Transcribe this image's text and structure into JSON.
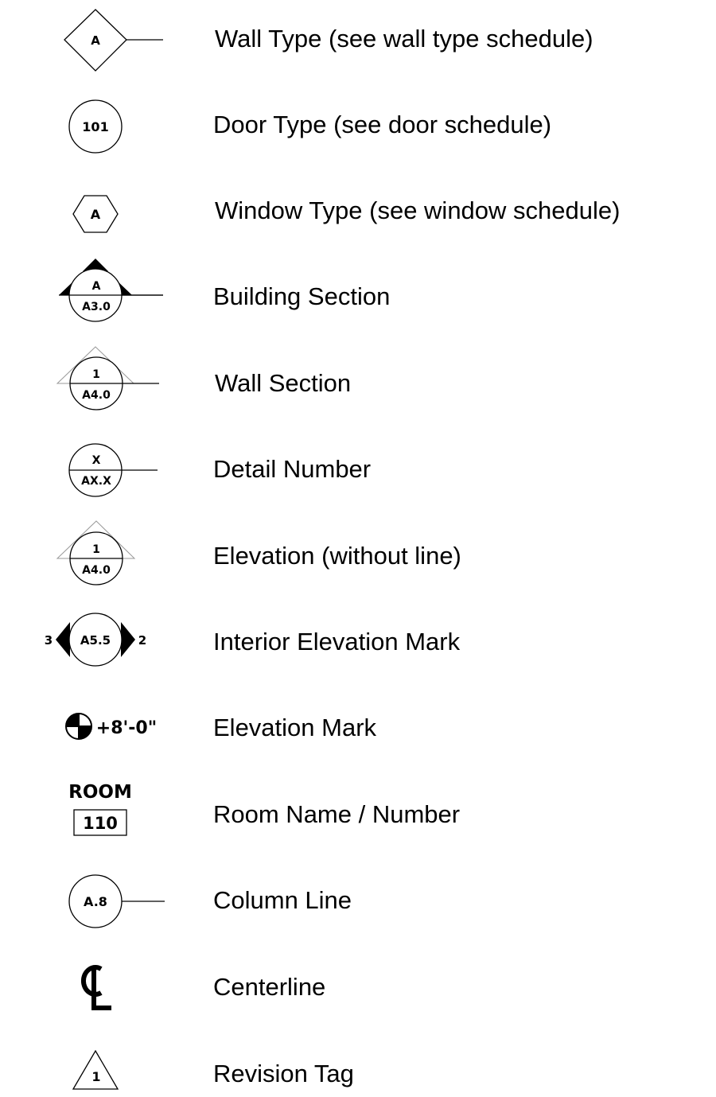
{
  "legend": {
    "items": [
      {
        "symbol": "wall-type-diamond",
        "tag": "A",
        "label": "Wall Type (see wall type schedule)"
      },
      {
        "symbol": "door-type-circle",
        "tag": "101",
        "label": "Door Type (see door schedule)"
      },
      {
        "symbol": "window-type-hexagon",
        "tag": "A",
        "label": "Window Type (see window schedule)"
      },
      {
        "symbol": "building-section-marker",
        "tag_top": "A",
        "tag_bottom": "A3.0",
        "label": "Building Section"
      },
      {
        "symbol": "wall-section-marker",
        "tag_top": "1",
        "tag_bottom": "A4.0",
        "label": "Wall Section"
      },
      {
        "symbol": "detail-number-marker",
        "tag_top": "X",
        "tag_bottom": "AX.X",
        "label": "Detail Number"
      },
      {
        "symbol": "elevation-marker",
        "tag_top": "1",
        "tag_bottom": "A4.0",
        "label": "Elevation (without line)"
      },
      {
        "symbol": "interior-elevation-mark",
        "tag": "A5.5",
        "left_num": "3",
        "right_num": "2",
        "label": "Interior Elevation Mark"
      },
      {
        "symbol": "elevation-datum-mark",
        "value": "+8'-0\"",
        "label": "Elevation Mark"
      },
      {
        "symbol": "room-tag",
        "room_word": "ROOM",
        "room_number": "110",
        "label": "Room Name / Number"
      },
      {
        "symbol": "column-line-bubble",
        "tag": "A.8",
        "label": "Column Line"
      },
      {
        "symbol": "centerline-glyph",
        "label": "Centerline"
      },
      {
        "symbol": "revision-triangle",
        "tag": "1",
        "label": "Revision Tag"
      }
    ]
  }
}
